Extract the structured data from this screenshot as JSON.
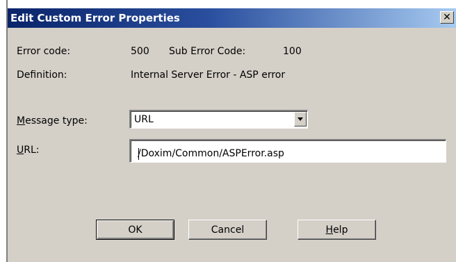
{
  "dialog": {
    "title": "Edit Custom Error Properties",
    "close_symbol": "✕"
  },
  "fields": {
    "error_code_label": "Error code:",
    "error_code_value": "500",
    "sub_error_code_label": "Sub Error Code:",
    "sub_error_code_value": "100",
    "definition_label": "Definition:",
    "definition_value": "Internal Server Error - ASP error",
    "message_type_label": {
      "accel": "M",
      "rest": "essage type:"
    },
    "message_type_value": "URL",
    "url_label": {
      "accel": "U",
      "rest": "RL:"
    },
    "url_value": "/Doxim/Common/ASPError.asp"
  },
  "buttons": {
    "ok": "OK",
    "cancel": "Cancel",
    "help": {
      "accel": "H",
      "rest": "elp"
    }
  },
  "icons": {
    "close": "close-icon",
    "dropdown": "chevron-down-icon"
  }
}
